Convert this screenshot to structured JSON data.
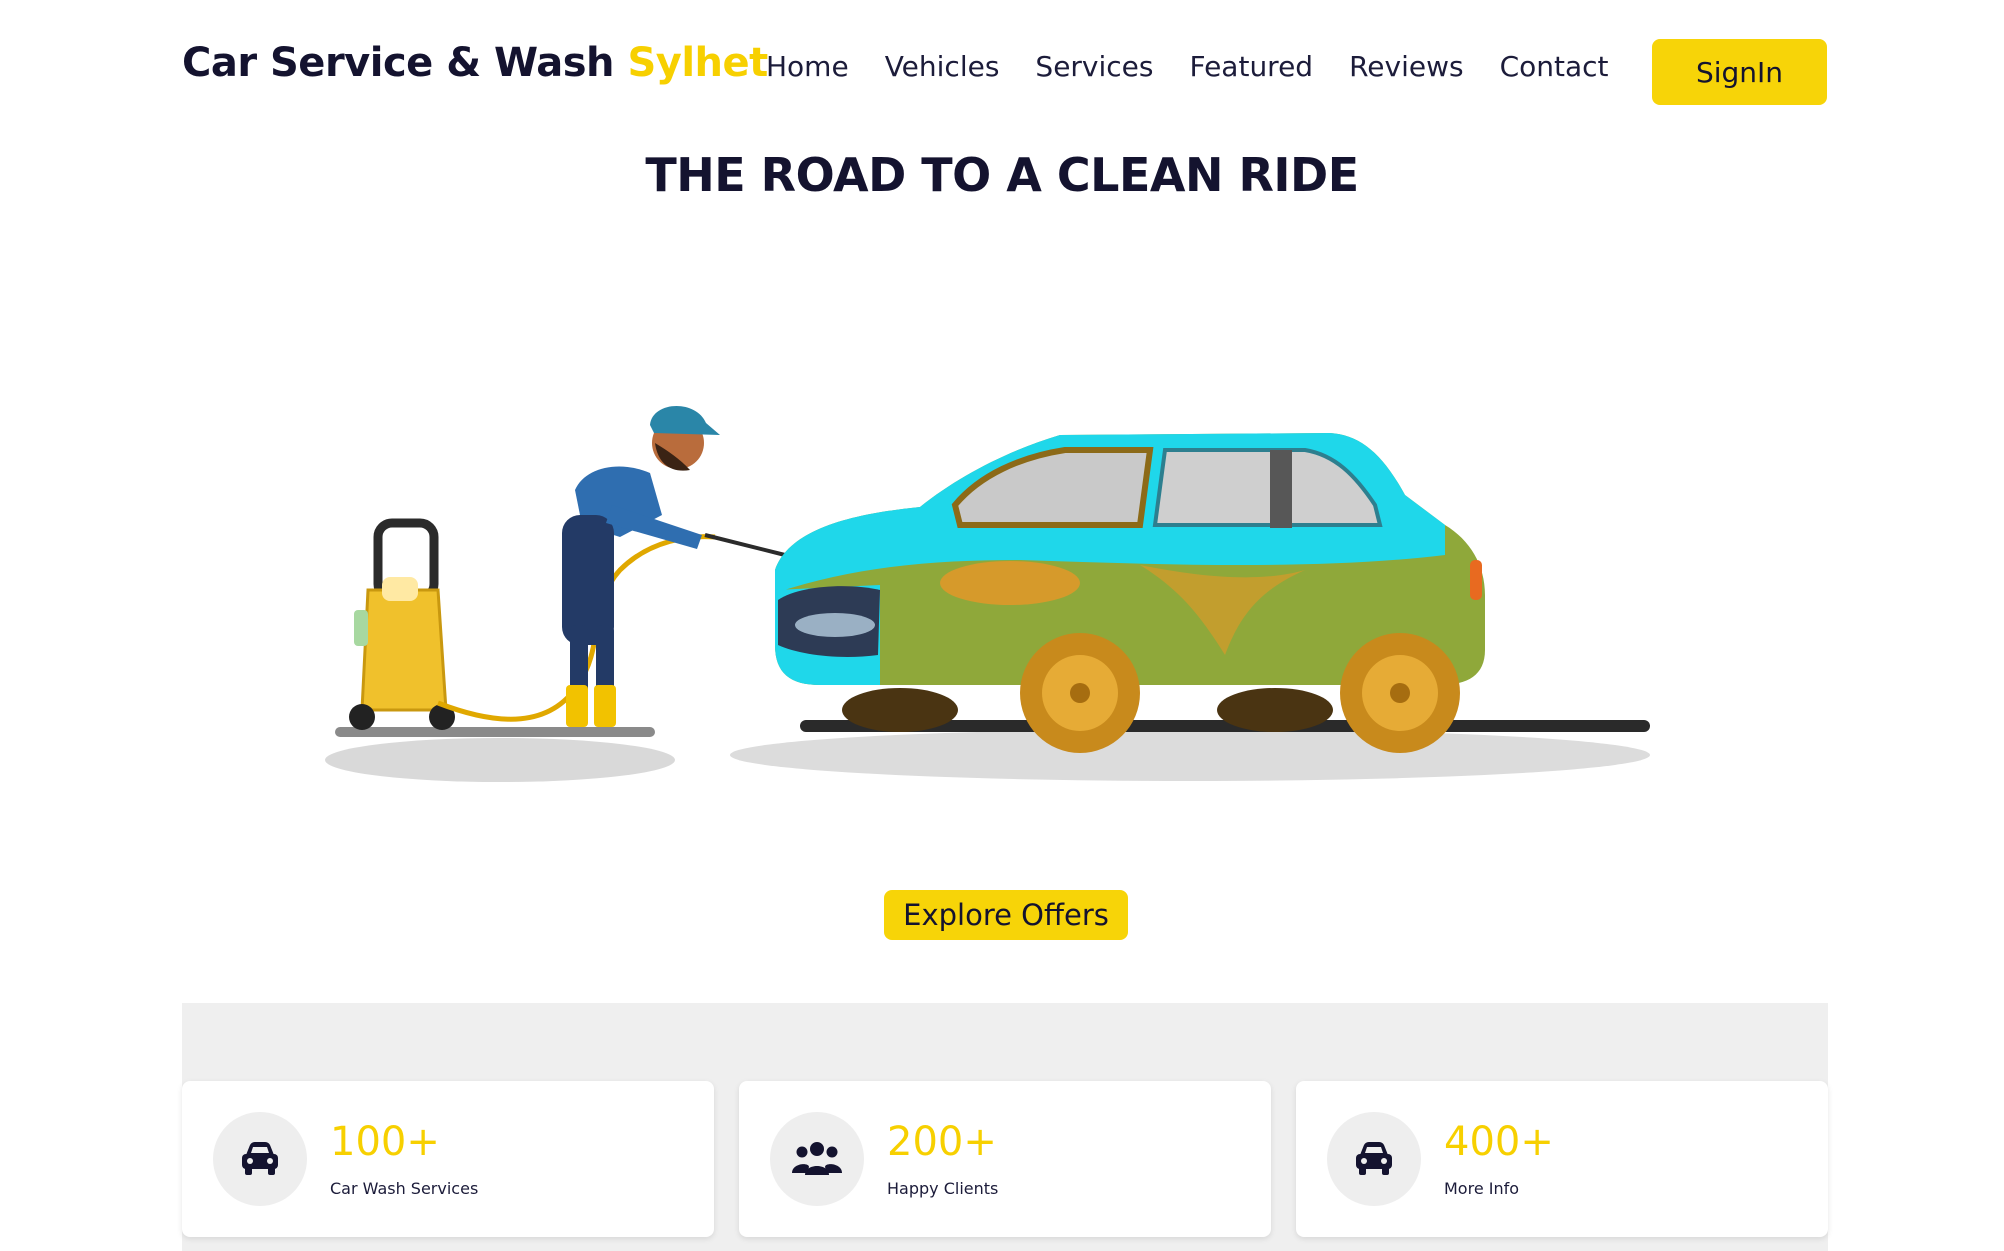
{
  "brand": {
    "name": "Car Service & Wash",
    "accent": "Sylhet"
  },
  "nav": {
    "items": [
      {
        "label": "Home"
      },
      {
        "label": "Vehicles"
      },
      {
        "label": "Services"
      },
      {
        "label": "Featured"
      },
      {
        "label": "Reviews"
      },
      {
        "label": "Contact"
      }
    ],
    "signin_label": "SignIn"
  },
  "hero": {
    "title": "THE ROAD TO A CLEAN RIDE",
    "cta_label": "Explore Offers"
  },
  "stats": [
    {
      "value": "100+",
      "label": "Car Wash Services",
      "icon": "car-icon"
    },
    {
      "value": "200+",
      "label": "Happy Clients",
      "icon": "users-icon"
    },
    {
      "value": "400+",
      "label": "More Info",
      "icon": "car-icon"
    }
  ],
  "colors": {
    "accent": "#f7d408",
    "heading": "#14132f",
    "band": "#efefef"
  }
}
